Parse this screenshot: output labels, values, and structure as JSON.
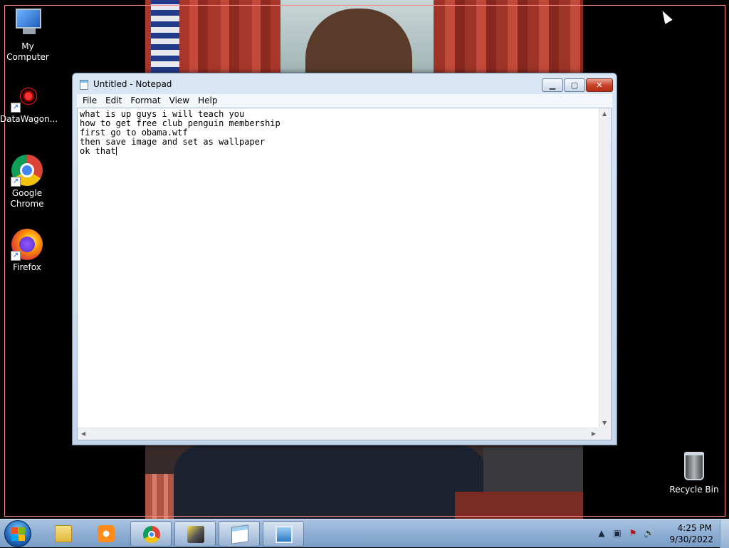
{
  "desktop": {
    "icons": [
      {
        "label": "My Computer",
        "icon": "computer-icon"
      },
      {
        "label": "DataWagon...",
        "icon": "datawagon-icon"
      },
      {
        "label": "Google Chrome",
        "icon": "chrome-icon"
      },
      {
        "label": "Firefox",
        "icon": "firefox-icon"
      },
      {
        "label": "Recycle Bin",
        "icon": "recycle-bin-icon"
      }
    ]
  },
  "notepad": {
    "title": "Untitled - Notepad",
    "controls": {
      "minimize": "▁",
      "maximize": "▢",
      "close": "✕"
    },
    "menu": [
      "File",
      "Edit",
      "Format",
      "View",
      "Help"
    ],
    "text": "what is up guys i will teach you\nhow to get free club penguin membership\nfirst go to obama.wtf\nthen save image and set as wallpaper\nok that"
  },
  "taskbar": {
    "apps": [
      {
        "name": "explorer",
        "icon": "folder-icon"
      },
      {
        "name": "media-player",
        "icon": "media-player-icon"
      },
      {
        "name": "chrome",
        "icon": "chrome-icon"
      },
      {
        "name": "app",
        "icon": "app-icon"
      },
      {
        "name": "notepad",
        "icon": "notepad-icon"
      },
      {
        "name": "photo-viewer",
        "icon": "photo-viewer-icon"
      }
    ],
    "tray": {
      "time": "4:25 PM",
      "date": "9/30/2022"
    }
  },
  "colors": {
    "taskbar": "#8eaed4",
    "close_button": "#c8452d",
    "desktop_bg": "#000000"
  }
}
